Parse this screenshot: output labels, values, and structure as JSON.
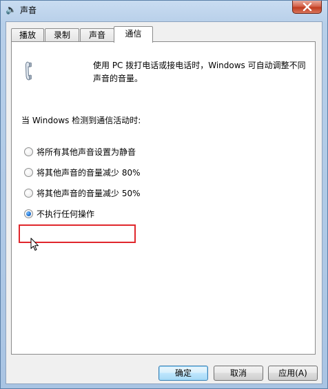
{
  "window": {
    "title": "声音",
    "icons": {
      "app": "speaker-icon",
      "close": "close-icon",
      "phone": "phone-icon",
      "cursor": "mouse-cursor-icon"
    },
    "colors": {
      "highlight_box": "#e0262b",
      "close_button": "#c03c1f",
      "radio_dot": "#1b6fd1"
    }
  },
  "tabs": [
    {
      "label": "播放",
      "active": false
    },
    {
      "label": "录制",
      "active": false
    },
    {
      "label": "声音",
      "active": false
    },
    {
      "label": "通信",
      "active": true
    }
  ],
  "content": {
    "description_line1": "使用 PC 拨打电话或接电话时，Windows 可自动调整不同",
    "description_line2": "声音的音量。",
    "section_label": "当 Windows 检测到通信活动时:",
    "options": [
      {
        "label": "将所有其他声音设置为静音",
        "selected": false
      },
      {
        "label": "将其他声音的音量减少 80%",
        "selected": false
      },
      {
        "label": "将其他声音的音量减少 50%",
        "selected": false
      },
      {
        "label": "不执行任何操作",
        "selected": true
      }
    ]
  },
  "buttons": {
    "ok": "确定",
    "cancel": "取消",
    "apply": "应用(A)"
  }
}
